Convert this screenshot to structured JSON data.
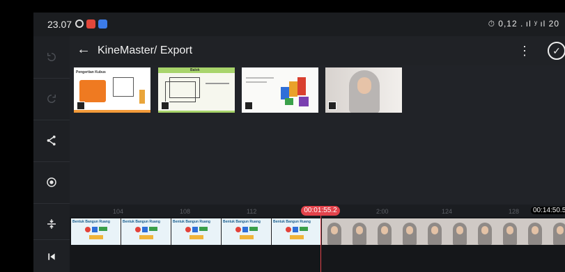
{
  "status_bar": {
    "time": "23.07",
    "right_indicators": "⏱ 0,12 . ıl ʸ ıl 20"
  },
  "header": {
    "title": "KineMaster/ Export"
  },
  "thumbnails": [
    {
      "title": "Pengertian Kubus",
      "kind": "slide-kubus"
    },
    {
      "title": "Balok",
      "kind": "slide-balok"
    },
    {
      "title": "",
      "kind": "slide-shapes"
    },
    {
      "title": "",
      "kind": "video-presenter"
    }
  ],
  "timeline": {
    "ticks": [
      "104",
      "108",
      "112",
      "2:00",
      "124",
      "128"
    ],
    "playhead_time": "00:01:55.2",
    "end_time": "00:14:50.5",
    "clip_label": "Bentuk Bangun Ruang"
  },
  "icons": {
    "undo": "undo-icon",
    "redo": "redo-icon",
    "share": "share-icon",
    "record": "record-icon",
    "split": "split-icon",
    "skip_start": "skip-to-start-icon",
    "back": "back-arrow-icon",
    "more": "more-vert-icon",
    "confirm": "check-circle-icon"
  },
  "colors": {
    "playhead": "#e2434b",
    "background": "#212328"
  }
}
